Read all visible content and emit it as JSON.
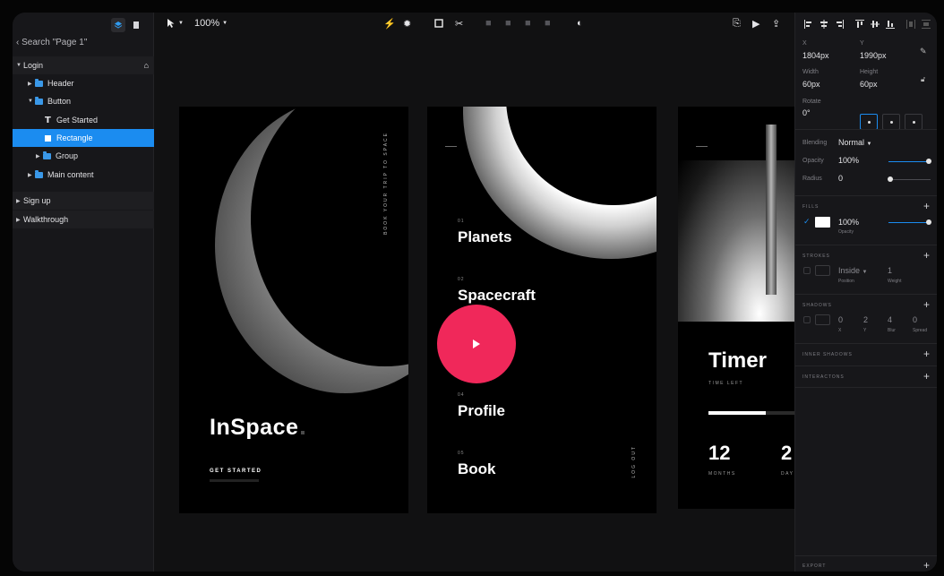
{
  "sidebar": {
    "search_label": "Search \"Page 1\"",
    "layers": [
      {
        "label": "Login"
      },
      {
        "label": "Header"
      },
      {
        "label": "Button"
      },
      {
        "label": "Get Started"
      },
      {
        "label": "Rectangle"
      },
      {
        "label": "Group"
      },
      {
        "label": "Main content"
      },
      {
        "label": "Sign up"
      },
      {
        "label": "Walkthrough"
      }
    ]
  },
  "toolbar": {
    "zoom": "100%"
  },
  "artboards": {
    "inspace": {
      "title": "InSpace",
      "vertical": "BOOK YOUR TRIP TO SPACE",
      "cta": "GET STARTED"
    },
    "menu": {
      "items": [
        {
          "num": "01",
          "label": "Planets"
        },
        {
          "num": "02",
          "label": "Spacecraft"
        },
        {
          "num": "04",
          "label": "Profile"
        },
        {
          "num": "05",
          "label": "Book"
        }
      ],
      "logout": "LOG OUT"
    },
    "timer": {
      "title": "Timer",
      "subtitle": "TIME LEFT",
      "progress": 0.67,
      "months_value": "12",
      "months_label": "MONTHS",
      "days_value": "2",
      "days_label": "DAY"
    }
  },
  "inspector": {
    "x_label": "X",
    "x_value": "1804px",
    "y_label": "Y",
    "y_value": "1990px",
    "width_label": "Width",
    "width_value": "60px",
    "height_label": "Height",
    "height_value": "60px",
    "rotate_label": "Rotate",
    "rotate_value": "0°",
    "blending_label": "Blending",
    "blending_value": "Normal",
    "opacity_label": "Opacity",
    "opacity_value": "100%",
    "radius_label": "Radius",
    "radius_value": "0",
    "fills_section": "FILLS",
    "fill_opacity": "100%",
    "fill_opacity_label": "Opacity",
    "fill_color": "#ffffff",
    "strokes_section": "STROKES",
    "stroke_position": "Inside",
    "stroke_position_label": "Position",
    "stroke_weight": "1",
    "stroke_weight_label": "Weight",
    "shadows_section": "SHADOWS",
    "shadow_values": [
      "0",
      "2",
      "4",
      "0"
    ],
    "shadow_labels": [
      "X",
      "Y",
      "Blur",
      "Spread"
    ],
    "inner_shadows_section": "INNER SHADOWS",
    "interactions_section": "INTERACTONS",
    "export_section": "EXPORT"
  },
  "colors": {
    "accent": "#1b8cf0",
    "play_button": "#f0285a"
  }
}
